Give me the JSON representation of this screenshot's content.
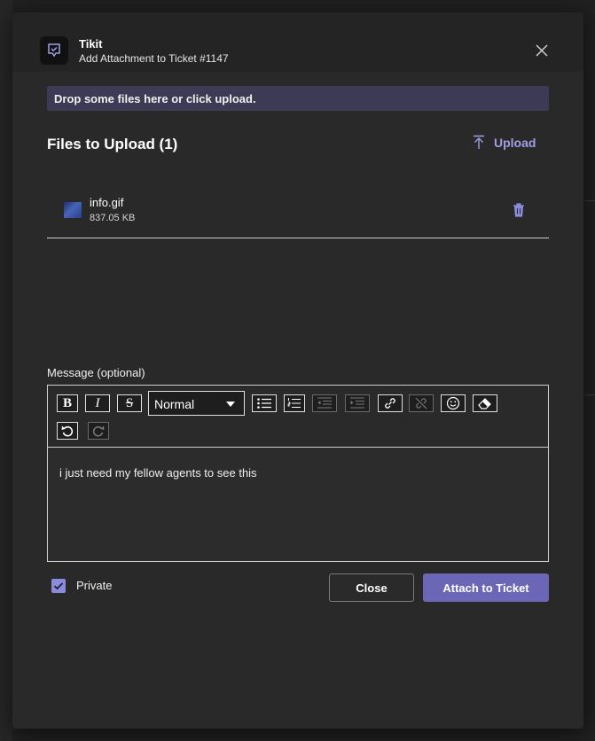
{
  "app": {
    "name": "Tikit",
    "subtitle": "Add Attachment to Ticket #1147"
  },
  "dropzone": {
    "text": "Drop some files here or click upload."
  },
  "files_section": {
    "title": "Files to Upload (1)",
    "upload_label": "Upload"
  },
  "files": [
    {
      "name": "info.gif",
      "size": "837.05 KB"
    }
  ],
  "message": {
    "label": "Message (optional)",
    "format_selected": "Normal",
    "text": "i just need my fellow agents to see this"
  },
  "footer": {
    "private_label": "Private",
    "private_checked": true,
    "close_label": "Close",
    "attach_label": "Attach to Ticket"
  },
  "colors": {
    "accent": "#6b67b6",
    "dropzone_bg": "#3c3a55",
    "link": "#9f9fe6"
  },
  "icons": [
    "tikit-logo-icon",
    "close-icon",
    "upload-icon",
    "trash-icon",
    "bold-icon",
    "italic-icon",
    "strikethrough-icon",
    "bullet-list-icon",
    "numbered-list-icon",
    "outdent-icon",
    "indent-icon",
    "link-icon",
    "unlink-icon",
    "emoji-icon",
    "clear-format-icon",
    "undo-icon",
    "redo-icon",
    "checkbox-check-icon"
  ]
}
